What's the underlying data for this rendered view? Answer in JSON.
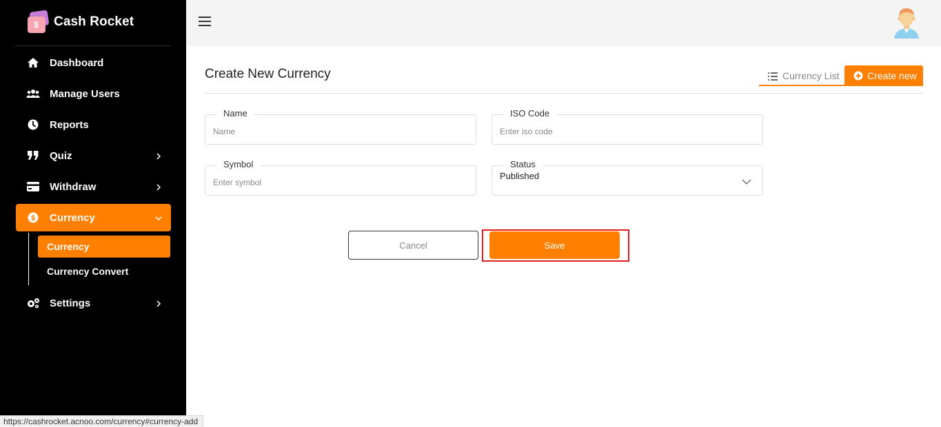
{
  "brand": {
    "name": "Cash Rocket"
  },
  "sidebar": {
    "items": [
      {
        "label": "Dashboard",
        "icon": "home-icon"
      },
      {
        "label": "Manage Users",
        "icon": "users-icon"
      },
      {
        "label": "Reports",
        "icon": "clock-icon"
      },
      {
        "label": "Quiz",
        "icon": "quote-icon"
      },
      {
        "label": "Withdraw",
        "icon": "credit-card-icon"
      },
      {
        "label": "Currency",
        "icon": "dollar-circle-icon"
      },
      {
        "label": "Settings",
        "icon": "gears-icon"
      }
    ],
    "currency_submenu": [
      {
        "label": "Currency"
      },
      {
        "label": "Currency Convert"
      }
    ]
  },
  "main": {
    "title": "Create New Currency",
    "tabs": {
      "list_label": "Currency List",
      "create_label": "Create new"
    },
    "form": {
      "name": {
        "label": "Name",
        "placeholder": "Name"
      },
      "iso_code": {
        "label": "ISO Code",
        "placeholder": "Enter iso code"
      },
      "symbol": {
        "label": "Symbol",
        "placeholder": "Enter symbol"
      },
      "status": {
        "label": "Status",
        "value": "Published"
      }
    },
    "buttons": {
      "cancel": "Cancel",
      "save": "Save"
    }
  },
  "status_bar": {
    "url": "https://cashrocket.acnoo.com/currency#currency-add"
  },
  "colors": {
    "accent": "#ff7f00",
    "sidebar_bg": "#000000",
    "highlight": "#e41b1b"
  }
}
